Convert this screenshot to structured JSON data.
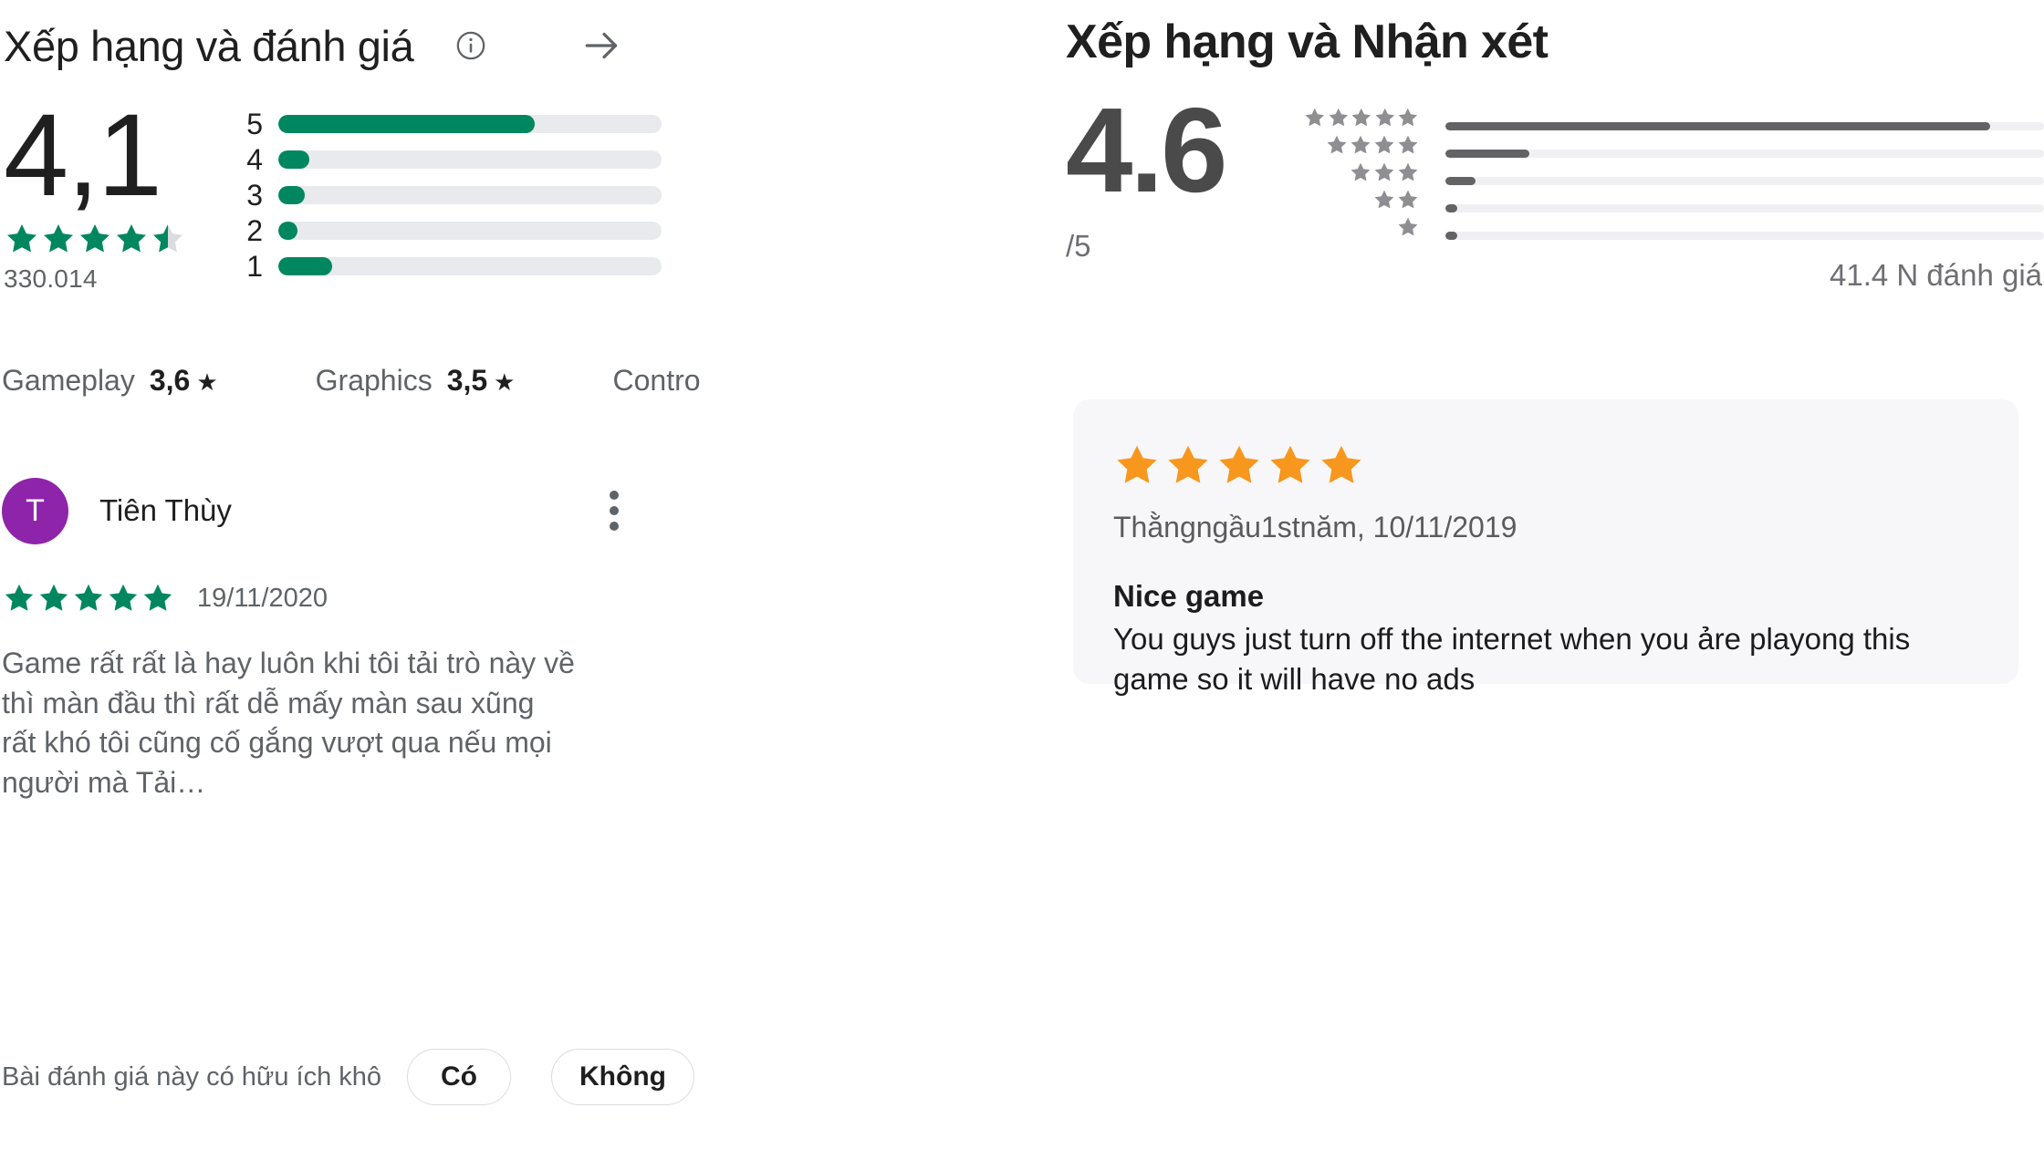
{
  "left_panel": {
    "title": "Xếp hạng và đánh giá",
    "info_icon": "info-icon",
    "arrow_icon": "arrow-right-icon",
    "score": "4,1",
    "stars_filled": 4,
    "stars_half": true,
    "rating_count": "330.014",
    "histogram": {
      "labels": [
        "5",
        "4",
        "3",
        "2",
        "1"
      ],
      "percents": [
        67,
        8,
        7,
        5,
        14
      ]
    },
    "aspect_chips": [
      {
        "label": "Gameplay",
        "value": "3,6",
        "star": "★"
      },
      {
        "label": "Graphics",
        "value": "3,5",
        "star": "★"
      },
      {
        "label": "Contro",
        "value": "",
        "star": ""
      }
    ],
    "review": {
      "avatar_initial": "T",
      "avatar_color": "#8e24aa",
      "author": "Tiên Thùy",
      "menu_icon": "more-vertical-icon",
      "stars": 5,
      "date": "19/11/2020",
      "body": "Game rất rất là hay luôn khi tôi tải trò này về thì màn đầu thì rất dễ mấy màn sau xũng rất khó tôi cũng cố gắng vượt qua nếu mọi người mà Tải…"
    },
    "helpful": {
      "question": "Bài đánh giá này có hữu ích khô…",
      "yes_label": "Có",
      "no_label": "Không"
    },
    "accent_color": "#01875f"
  },
  "right_panel": {
    "title": "Xếp hạng và Nhận xét",
    "score": "4.6",
    "out_of": "/5",
    "rating_count": "41.4 N đánh giá",
    "histogram": {
      "star_counts": [
        5,
        4,
        3,
        2,
        1
      ],
      "percents": [
        91,
        14,
        5,
        2,
        2
      ]
    },
    "review": {
      "stars": 5,
      "author_date": "Thằngngầu1stnăm, 10/11/2019",
      "title": "Nice game",
      "body": "You guys just turn off the internet when you ảre playong this game so it will have no ads"
    },
    "accent_color": "#f7971d",
    "bar_color": "#636366"
  },
  "chart_data": [
    {
      "type": "bar",
      "title": "Xếp hạng và đánh giá",
      "categories": [
        "5",
        "4",
        "3",
        "2",
        "1"
      ],
      "values": [
        67,
        8,
        7,
        5,
        14
      ],
      "xlabel": "",
      "ylabel": "Stars",
      "ylim": [
        0,
        100
      ],
      "average": 4.1,
      "total_ratings": "330.014",
      "grid": false,
      "legend": "none",
      "orientation": "horizontal",
      "color": "#01875f"
    },
    {
      "type": "bar",
      "title": "Xếp hạng và Nhận xét",
      "categories": [
        "5",
        "4",
        "3",
        "2",
        "1"
      ],
      "values": [
        91,
        14,
        5,
        2,
        2
      ],
      "xlabel": "",
      "ylabel": "Stars",
      "ylim": [
        0,
        100
      ],
      "average": 4.6,
      "total_ratings": "41.4 N đánh giá",
      "grid": false,
      "legend": "none",
      "orientation": "horizontal",
      "color": "#636366"
    }
  ]
}
